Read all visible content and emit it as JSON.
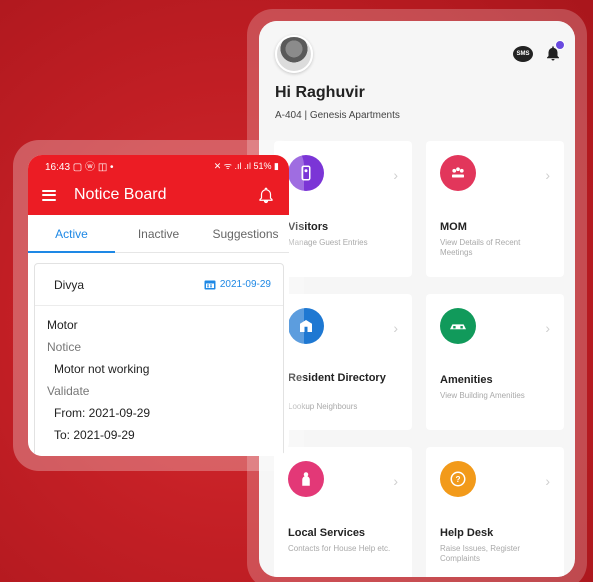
{
  "dashboard": {
    "greeting": "Hi Raghuvir",
    "address": "A-404 | Genesis Apartments",
    "sms_icon_text": "SMS",
    "tiles": [
      {
        "title": "Visitors",
        "subtitle": "Manage Guest Entries",
        "color": "#7b35d6",
        "icon": "visitor-icon"
      },
      {
        "title": "MOM",
        "subtitle": "View Details of Recent Meetings",
        "color": "#e2365b",
        "icon": "meeting-icon"
      },
      {
        "title": "Resident Directory",
        "subtitle": "Lookup Neighbours",
        "color": "#1e78d2",
        "icon": "directory-icon"
      },
      {
        "title": "Amenities",
        "subtitle": "View Building Amenities",
        "color": "#119a5b",
        "icon": "amenities-icon"
      },
      {
        "title": "Local Services",
        "subtitle": "Contacts for House Help etc.",
        "color": "#e33877",
        "icon": "services-icon"
      },
      {
        "title": "Help Desk",
        "subtitle": "Raise Issues, Register Complaints",
        "color": "#f29a1a",
        "icon": "helpdesk-icon"
      }
    ]
  },
  "notice": {
    "status_time": "16:43",
    "status_battery": "51%",
    "title": "Notice Board",
    "tabs": [
      "Active",
      "Inactive",
      "Suggestions"
    ],
    "card": {
      "name": "Divya",
      "date": "2021-09-29",
      "subject": "Motor",
      "notice_label": "Notice",
      "notice_text": "Motor not working",
      "validate_label": "Validate",
      "from": "From: 2021-09-29",
      "to": "To: 2021-09-29"
    }
  },
  "colors": {
    "background": "#c31f25",
    "app_bar": "#ec1c24",
    "accent_blue": "#1e88e5"
  }
}
